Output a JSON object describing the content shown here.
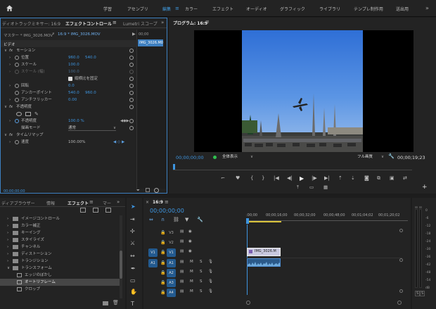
{
  "workspaces": [
    "学習",
    "アセンブリ",
    "編集",
    "カラー",
    "エフェクト",
    "オーディオ",
    "グラフィック",
    "ライブラリ",
    "テンプレ制作用",
    "送出用"
  ],
  "active_workspace": "編集",
  "effect_controls": {
    "tabs": [
      "ディオトラックミキサー: 16:9",
      "エフェクトコントロール",
      "Lumetri スコープ"
    ],
    "master_label": "マスター * IMG_3026.MOV",
    "clip_label": "16:9 * IMG_3026.MOV",
    "mini_time": "00;00",
    "mini_clip": "IMG_3026.M0",
    "section_video": "ビデオ",
    "rows": [
      {
        "label": "モーション",
        "value1": "",
        "value2": ""
      },
      {
        "label": "位置",
        "value1": "960.0",
        "value2": "540.0"
      },
      {
        "label": "スケール",
        "value1": "100.0",
        "value2": ""
      },
      {
        "label": "スケール (幅)",
        "value1": "100.0",
        "value2": ""
      },
      {
        "label": "縦横比を固定",
        "value1": "",
        "value2": ""
      },
      {
        "label": "回転",
        "value1": "0.0",
        "value2": ""
      },
      {
        "label": "アンカーポイント",
        "value1": "540.0",
        "value2": "960.0"
      },
      {
        "label": "アンチフリッカー",
        "value1": "0.00",
        "value2": ""
      },
      {
        "label": "不透明度",
        "value1": "",
        "value2": ""
      },
      {
        "label": "不透明度",
        "value1": "100.0 %",
        "value2": ""
      },
      {
        "label": "描画モード",
        "value1": "通常",
        "value2": ""
      },
      {
        "label": "タイムリマップ",
        "value1": "",
        "value2": ""
      },
      {
        "label": "速度",
        "value1": "100.00%",
        "value2": ""
      }
    ],
    "fx": "fx",
    "timecode": "00;00;00;00"
  },
  "program": {
    "title": "プログラム: 16:9",
    "timecode": "00;00;00;00",
    "fit": "全体表示",
    "quality": "フル画質",
    "duration": "00;00;19;23"
  },
  "project": {
    "tabs": [
      "ディアブラウザー",
      "情報",
      "エフェクト",
      "マー"
    ],
    "items": [
      "イメージコントロール",
      "カラー補正",
      "キーイング",
      "スタイライズ",
      "チャンネル",
      "ディストーション",
      "トランジション",
      "トランスフォーム",
      "エッジのぼかし",
      "オートリフレーム",
      "クロップ"
    ]
  },
  "timeline": {
    "title": "16:9",
    "timecode": "00;00;00;00",
    "ruler": [
      ":00;00",
      "00;00;16;00",
      "00;00;32;00",
      "00;00;48;00",
      "00;01;04;02",
      "00;01;20;02"
    ],
    "video_tracks": [
      "V3",
      "V2",
      "V1"
    ],
    "audio_tracks": [
      "A1",
      "A2",
      "A3",
      "A4"
    ],
    "src_v": "V1",
    "src_a": "A1",
    "video_clip": "IMG_3026.M",
    "M": "M",
    "S": "S"
  },
  "meter": {
    "scale": [
      "0",
      "-6",
      "-12",
      "-18",
      "-24",
      "-30",
      "-36",
      "-42",
      "-48",
      "-54",
      "dB"
    ],
    "solo": [
      "S",
      "S"
    ]
  }
}
